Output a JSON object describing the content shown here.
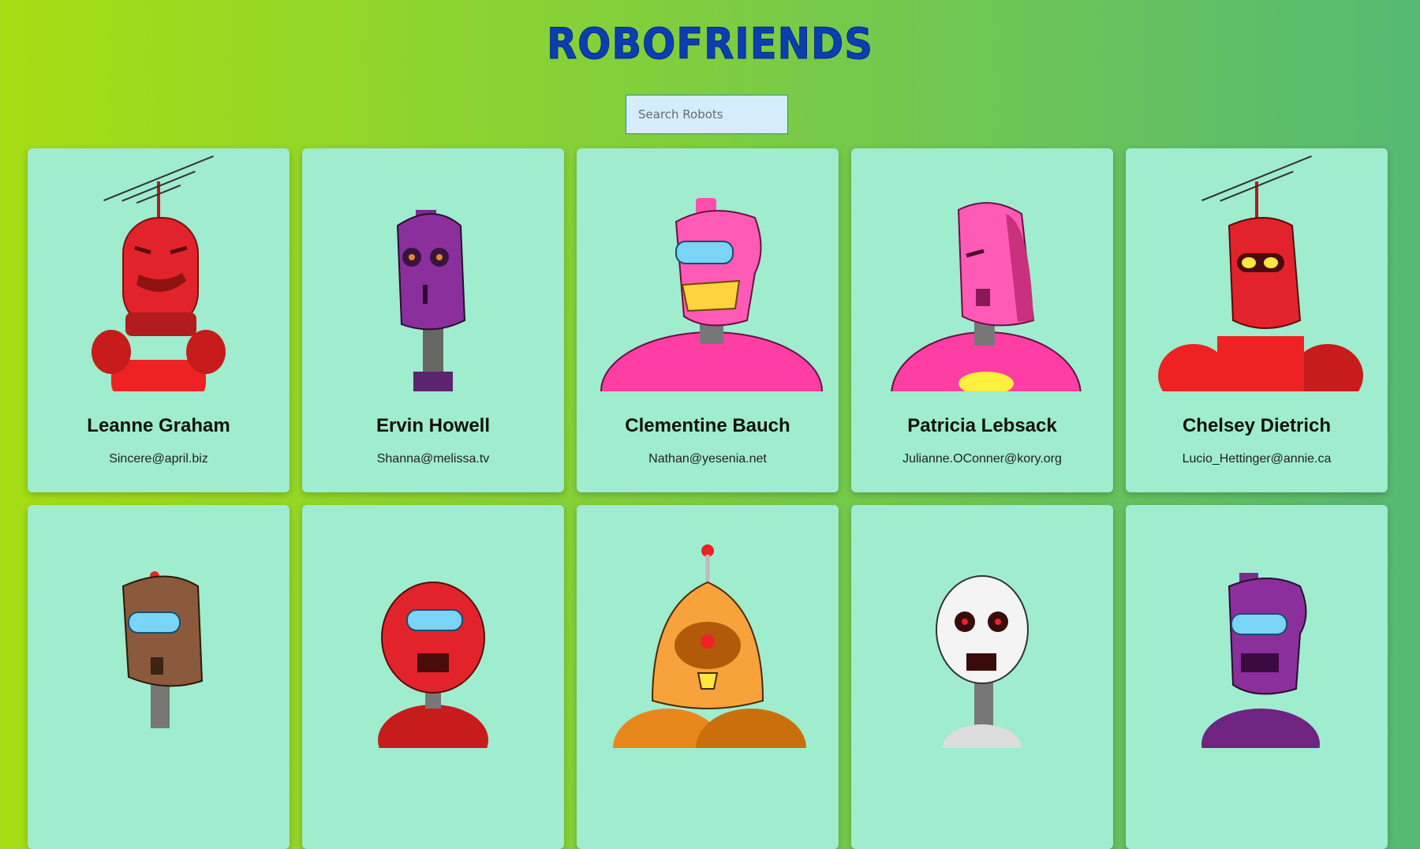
{
  "header": {
    "title": "ROBOFRIENDS"
  },
  "search": {
    "placeholder": "Search Robots"
  },
  "robots": [
    {
      "name": "Leanne Graham",
      "email": "Sincere@april.biz",
      "robot": "red-antenna-robot-icon"
    },
    {
      "name": "Ervin Howell",
      "email": "Shanna@melissa.tv",
      "robot": "purple-robot-icon"
    },
    {
      "name": "Clementine Bauch",
      "email": "Nathan@yesenia.net",
      "robot": "pink-grin-robot-icon"
    },
    {
      "name": "Patricia Lebsack",
      "email": "Julianne.OConner@kory.org",
      "robot": "pink-robot-icon"
    },
    {
      "name": "Chelsey Dietrich",
      "email": "Lucio_Hettinger@annie.ca",
      "robot": "red-yellow-eyes-robot-icon"
    },
    {
      "robot": "brown-robot-icon"
    },
    {
      "robot": "red-visor-robot-icon"
    },
    {
      "robot": "orange-cyclops-robot-icon"
    },
    {
      "robot": "white-skull-robot-icon"
    },
    {
      "robot": "purple-visor-robot-icon"
    }
  ],
  "colors": {
    "background_left": "#a6de13",
    "background_right": "#55ba73",
    "card": "#9feccf",
    "title": "#0a3fb0",
    "search_bg": "#d4ecfb"
  }
}
